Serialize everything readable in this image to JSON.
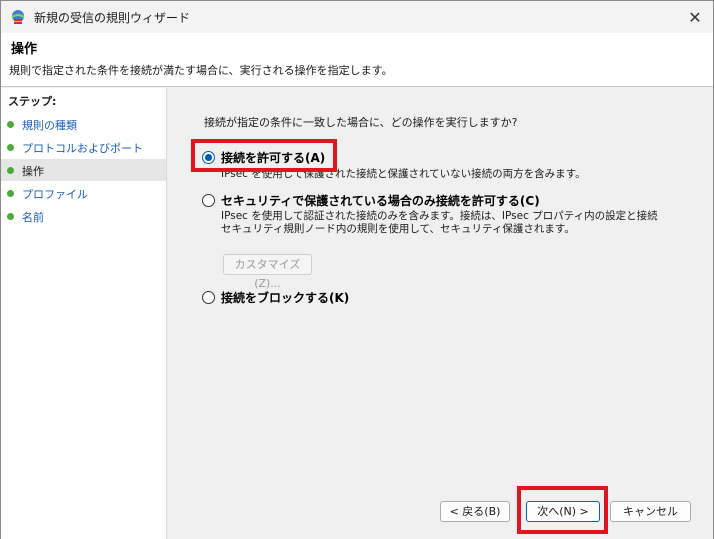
{
  "window": {
    "title": "新規の受信の規則ウィザード",
    "close_glyph": "✕"
  },
  "header": {
    "title": "操作",
    "description": "規則で指定された条件を接続が満たす場合に、実行される操作を指定します。"
  },
  "sidebar": {
    "steps_label": "ステップ:",
    "items": [
      {
        "label": "規則の種類",
        "state": "link"
      },
      {
        "label": "プロトコルおよびポート",
        "state": "link"
      },
      {
        "label": "操作",
        "state": "current"
      },
      {
        "label": "プロファイル",
        "state": "link"
      },
      {
        "label": "名前",
        "state": "link"
      }
    ]
  },
  "main": {
    "question": "接続が指定の条件に一致した場合に、どの操作を実行しますか?",
    "options": [
      {
        "label": "接続を許可する(A)",
        "checked": true,
        "desc": [
          "IPsec を使用して保護された接続と保護されていない接続の両方を含みます。"
        ]
      },
      {
        "label": "セキュリティで保護されている場合のみ接続を許可する(C)",
        "checked": false,
        "desc": [
          "IPsec を使用して認証された接続のみを含みます。接続は、IPsec プロパティ内の設定と接続",
          "セキュリティ規則ノード内の規則を使用して、セキュリティ保護されます。"
        ]
      },
      {
        "label": "接続をブロックする(K)",
        "checked": false,
        "desc": []
      }
    ],
    "customize_label": "カスタマイズ(Z)..."
  },
  "buttons": {
    "back": "< 戻る(B)",
    "next": "次へ(N) >",
    "cancel": "キャンセル"
  },
  "colors": {
    "highlight": "#e3141d",
    "step_dot": "#4aa93a",
    "link": "#1a5fb4",
    "radio_accent": "#0058b8"
  }
}
